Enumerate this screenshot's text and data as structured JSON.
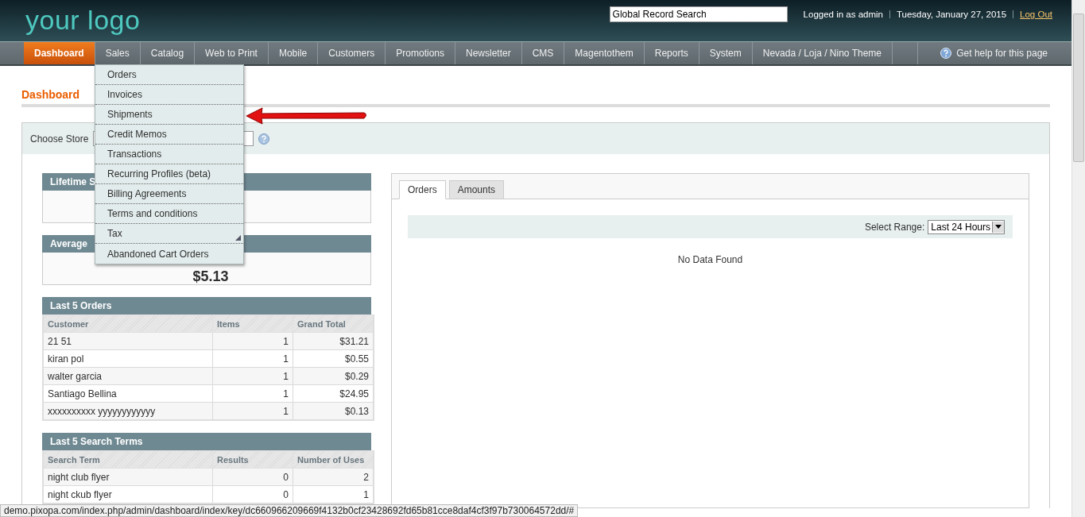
{
  "header": {
    "logo": "your logo",
    "search": {
      "value": "Global Record Search"
    },
    "user": "Logged in as admin",
    "date": "Tuesday, January 27, 2015",
    "logout": "Log Out"
  },
  "nav": {
    "items": [
      {
        "label": "Dashboard",
        "selected": true
      },
      {
        "label": "Sales",
        "selected": false
      },
      {
        "label": "Catalog",
        "selected": false
      },
      {
        "label": "Web to Print",
        "selected": false
      },
      {
        "label": "Mobile",
        "selected": false
      },
      {
        "label": "Customers",
        "selected": false
      },
      {
        "label": "Promotions",
        "selected": false
      },
      {
        "label": "Newsletter",
        "selected": false
      },
      {
        "label": "CMS",
        "selected": false
      },
      {
        "label": "Magentothem",
        "selected": false
      },
      {
        "label": "Reports",
        "selected": false
      },
      {
        "label": "System",
        "selected": false
      },
      {
        "label": "Nevada / Loja / Nino Theme",
        "selected": false
      }
    ],
    "help": "Get help for this page"
  },
  "sales_menu": {
    "items": [
      {
        "label": "Orders",
        "submenu": false
      },
      {
        "label": "Invoices",
        "submenu": false
      },
      {
        "label": "Shipments",
        "submenu": false
      },
      {
        "label": "Credit Memos",
        "submenu": false
      },
      {
        "label": "Transactions",
        "submenu": false
      },
      {
        "label": "Recurring Profiles (beta)",
        "submenu": false
      },
      {
        "label": "Billing Agreements",
        "submenu": false
      },
      {
        "label": "Terms and conditions",
        "submenu": false
      },
      {
        "label": "Tax",
        "submenu": true
      },
      {
        "label": "Abandoned Cart Orders",
        "submenu": false
      }
    ]
  },
  "page_title": "Dashboard",
  "store_switcher": {
    "label": "Choose Store"
  },
  "lifetime_sales": {
    "title": "Lifetime S"
  },
  "average_order": {
    "title": "Average",
    "value": "$5.13"
  },
  "last_orders": {
    "title": "Last 5 Orders",
    "columns": [
      "Customer",
      "Items",
      "Grand Total"
    ],
    "rows": [
      [
        "21 51",
        "1",
        "$31.21"
      ],
      [
        "kiran pol",
        "1",
        "$0.55"
      ],
      [
        "walter garcia",
        "1",
        "$0.29"
      ],
      [
        "Santiago Bellina",
        "1",
        "$24.95"
      ],
      [
        "xxxxxxxxxx yyyyyyyyyyyy",
        "1",
        "$0.13"
      ]
    ]
  },
  "search_terms": {
    "title": "Last 5 Search Terms",
    "columns": [
      "Search Term",
      "Results",
      "Number of Uses"
    ],
    "rows": [
      [
        "night club flyer",
        "0",
        "2"
      ],
      [
        "night ckub flyer",
        "0",
        "1"
      ]
    ]
  },
  "chart_panel": {
    "tabs": [
      {
        "label": "Orders",
        "selected": true
      },
      {
        "label": "Amounts",
        "selected": false
      }
    ],
    "range_label": "Select Range:",
    "range_value": "Last 24 Hours",
    "message": "No Data Found"
  },
  "status_bar": {
    "url": "demo.pixopa.com/index.php/admin/dashboard/index/key/dc660966209669f4132b0cf23428692fd65b81cce8daf4cf3f97b730064572dd/#"
  }
}
